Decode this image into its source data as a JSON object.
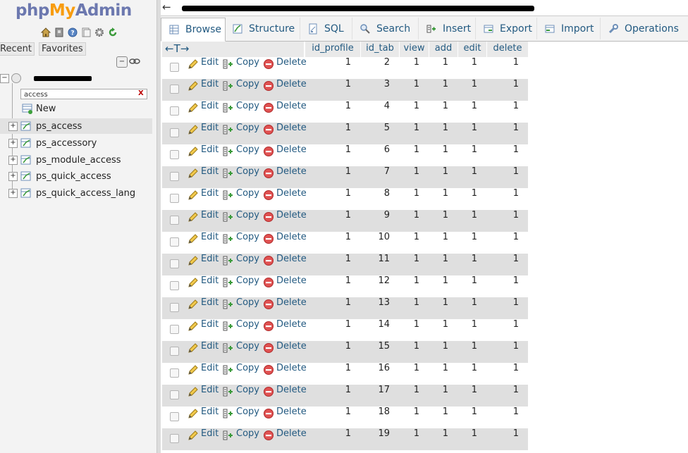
{
  "nav": {
    "logo": {
      "php": "php",
      "my": "My",
      "admin": "Admin"
    },
    "quick_icons": [
      "home-icon",
      "logout-icon",
      "help-icon",
      "docs-icon",
      "settings-icon",
      "reload-icon"
    ],
    "tabs": {
      "recent": "Recent",
      "favorites": "Favorites"
    },
    "filter": {
      "value": "access",
      "clear": "X"
    },
    "new_label": "New",
    "tables": [
      "ps_access",
      "ps_accessory",
      "ps_module_access",
      "ps_quick_access",
      "ps_quick_access_lang"
    ],
    "selected_table": "ps_access"
  },
  "topbar": {
    "back": "←"
  },
  "tabs": [
    {
      "label": "Browse",
      "icon": "browse-icon"
    },
    {
      "label": "Structure",
      "icon": "structure-icon"
    },
    {
      "label": "SQL",
      "icon": "sql-icon"
    },
    {
      "label": "Search",
      "icon": "search-icon"
    },
    {
      "label": "Insert",
      "icon": "insert-icon"
    },
    {
      "label": "Export",
      "icon": "export-icon"
    },
    {
      "label": "Import",
      "icon": "import-icon"
    },
    {
      "label": "Operations",
      "icon": "operations-icon"
    }
  ],
  "table": {
    "sort_arrows": "←T→",
    "columns": [
      "id_profile",
      "id_tab",
      "view",
      "add",
      "edit",
      "delete"
    ],
    "actions": {
      "edit": "Edit",
      "copy": "Copy",
      "delete": "Delete"
    },
    "rows": [
      [
        "1",
        "2",
        "1",
        "1",
        "1",
        "1"
      ],
      [
        "1",
        "3",
        "1",
        "1",
        "1",
        "1"
      ],
      [
        "1",
        "4",
        "1",
        "1",
        "1",
        "1"
      ],
      [
        "1",
        "5",
        "1",
        "1",
        "1",
        "1"
      ],
      [
        "1",
        "6",
        "1",
        "1",
        "1",
        "1"
      ],
      [
        "1",
        "7",
        "1",
        "1",
        "1",
        "1"
      ],
      [
        "1",
        "8",
        "1",
        "1",
        "1",
        "1"
      ],
      [
        "1",
        "9",
        "1",
        "1",
        "1",
        "1"
      ],
      [
        "1",
        "10",
        "1",
        "1",
        "1",
        "1"
      ],
      [
        "1",
        "11",
        "1",
        "1",
        "1",
        "1"
      ],
      [
        "1",
        "12",
        "1",
        "1",
        "1",
        "1"
      ],
      [
        "1",
        "13",
        "1",
        "1",
        "1",
        "1"
      ],
      [
        "1",
        "14",
        "1",
        "1",
        "1",
        "1"
      ],
      [
        "1",
        "15",
        "1",
        "1",
        "1",
        "1"
      ],
      [
        "1",
        "16",
        "1",
        "1",
        "1",
        "1"
      ],
      [
        "1",
        "17",
        "1",
        "1",
        "1",
        "1"
      ],
      [
        "1",
        "18",
        "1",
        "1",
        "1",
        "1"
      ],
      [
        "1",
        "19",
        "1",
        "1",
        "1",
        "1"
      ]
    ]
  },
  "colors": {
    "link": "#235a81",
    "row_even": "#dfdfdf",
    "header": "#e9e9e9",
    "nav_bg": "#f3f3f3"
  }
}
